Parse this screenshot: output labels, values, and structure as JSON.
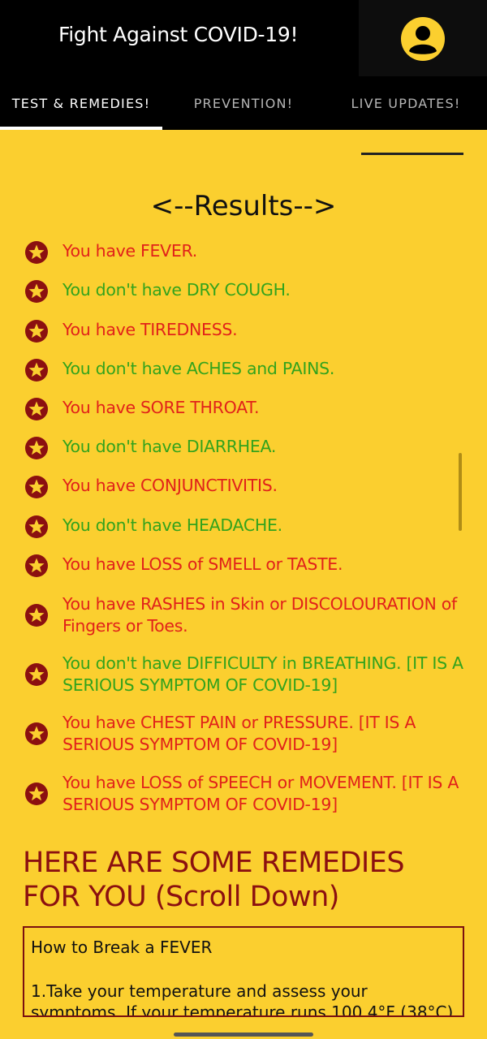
{
  "app": {
    "title": "Fight Against COVID-19!"
  },
  "tabs": [
    {
      "label": "TEST & REMEDIES!"
    },
    {
      "label": "PREVENTION!"
    },
    {
      "label": "LIVE UPDATES!"
    }
  ],
  "results": {
    "heading": "<--Results-->",
    "items": [
      {
        "text": "You have FEVER.",
        "status": "positive"
      },
      {
        "text": "You don't have DRY COUGH.",
        "status": "negative"
      },
      {
        "text": "You have TIREDNESS.",
        "status": "positive"
      },
      {
        "text": "You don't have ACHES and PAINS.",
        "status": "negative"
      },
      {
        "text": "You have SORE THROAT.",
        "status": "positive"
      },
      {
        "text": "You don't have DIARRHEA.",
        "status": "negative"
      },
      {
        "text": "You have CONJUNCTIVITIS.",
        "status": "positive"
      },
      {
        "text": "You don't have HEADACHE.",
        "status": "negative"
      },
      {
        "text": "You have LOSS of SMELL or TASTE.",
        "status": "positive"
      },
      {
        "text": "You have RASHES in Skin or DISCOLOURATION of Fingers or Toes.",
        "status": "positive"
      },
      {
        "text": "You don't have DIFFICULTY in BREATHING. [IT IS A SERIOUS SYMPTOM OF COVID-19]",
        "status": "negative"
      },
      {
        "text": "You have CHEST PAIN or PRESSURE. [IT IS A SERIOUS SYMPTOM OF COVID-19]",
        "status": "positive"
      },
      {
        "text": "You have LOSS of SPEECH or MOVEMENT. [IT IS A SERIOUS SYMPTOM OF COVID-19]",
        "status": "positive"
      }
    ]
  },
  "remedies": {
    "heading": "HERE ARE SOME REMEDIES FOR YOU (Scroll Down)",
    "box_title": "How to Break a  FEVER",
    "box_body": "1.Take your temperature and assess your symptoms. If your temperature runs 100.4°F (38°C)"
  },
  "colors": {
    "background": "#fbcf2f",
    "positive": "#e1221a",
    "negative": "#33a31c",
    "remedy_heading": "#8b1010"
  },
  "icons": {
    "profile": "account-circle-icon",
    "bullet": "star-circle-icon"
  }
}
